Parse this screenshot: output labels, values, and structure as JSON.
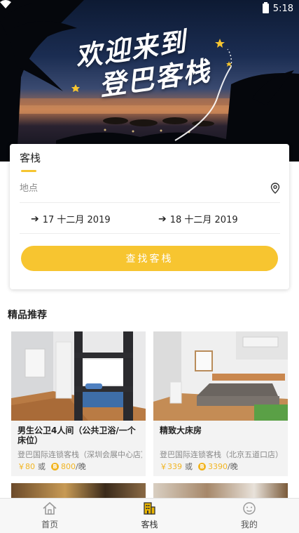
{
  "status_bar": {
    "time": "5:18"
  },
  "hero": {
    "welcome_line1": "欢迎来到",
    "welcome_line2": "登巴客栈"
  },
  "search": {
    "tab_label": "客栈",
    "location_placeholder": "地点",
    "check_in": "17 十二月 2019",
    "check_out": "18 十二月 2019",
    "button_label": "查找客栈"
  },
  "section": {
    "title": "精品推荐"
  },
  "listings": [
    {
      "name": "男生公卫4人间（公共卫浴/一个床位）",
      "address": "登巴国际连锁客栈（深圳会展中心店）",
      "price": "￥80",
      "or": "或",
      "coins": "800",
      "unit": "/晚"
    },
    {
      "name": "精致大床房",
      "address": "登巴国际连锁客栈（北京五道口店）",
      "price": "￥339",
      "or": "或",
      "coins": "3390",
      "unit": "/晚"
    }
  ],
  "colors": {
    "accent": "#f7c530",
    "price": "#f2b522"
  },
  "nav": [
    {
      "label": "首页",
      "icon": "home-icon"
    },
    {
      "label": "客栈",
      "icon": "hotel-icon"
    },
    {
      "label": "我的",
      "icon": "profile-icon"
    }
  ]
}
